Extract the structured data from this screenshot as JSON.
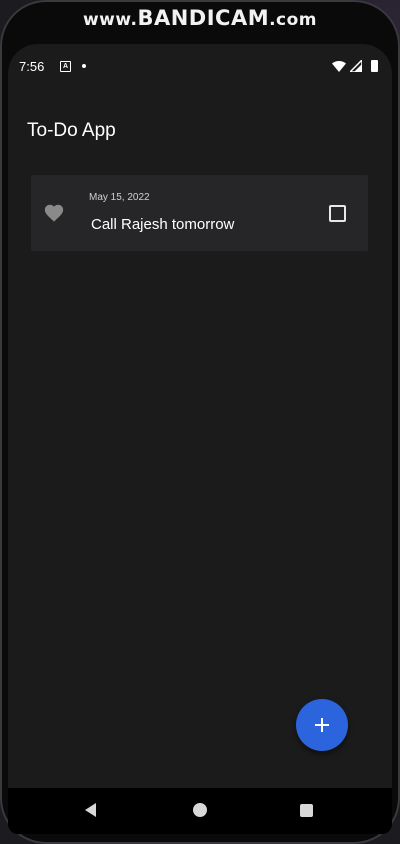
{
  "watermark": {
    "prefix": "www.",
    "brand": "BANDICAM",
    "suffix": ".com"
  },
  "status_bar": {
    "time": "7:56",
    "a_icon_glyph": "A",
    "icons": [
      "app-notification-icon",
      "dot-icon",
      "wifi-icon",
      "signal-icon",
      "battery-icon"
    ]
  },
  "app_bar": {
    "title": "To-Do App"
  },
  "todos": [
    {
      "date": "May 15, 2022",
      "text": "Call Rajesh tomorrow",
      "favorite": true,
      "checked": false
    }
  ],
  "fab": {
    "icon": "add-icon"
  },
  "nav_bar": {
    "icons": [
      "back-icon",
      "home-icon",
      "recents-icon"
    ]
  },
  "colors": {
    "screen_background": "#1b1b1b",
    "card_background": "#262629",
    "fab_background": "#2b64dd",
    "heart_icon": "#8a8a8a",
    "text_primary": "#ffffff"
  }
}
